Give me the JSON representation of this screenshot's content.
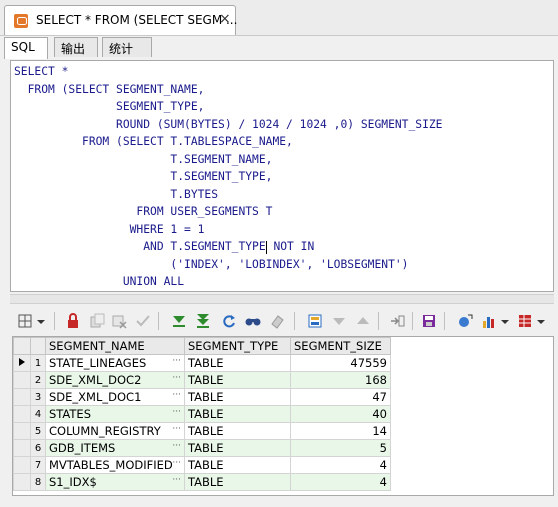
{
  "document_tab": {
    "title": "SELECT * FROM (SELECT SEGM ...",
    "close_icon": "×"
  },
  "sub_tabs": [
    {
      "label": "SQL",
      "active": true
    },
    {
      "label": "输出",
      "active": false
    },
    {
      "label": "统计",
      "active": false
    }
  ],
  "sql_lines": [
    "SELECT *",
    "  FROM (SELECT SEGMENT_NAME,",
    "               SEGMENT_TYPE,",
    "               ROUND (SUM(BYTES) / 1024 / 1024 ,0) SEGMENT_SIZE",
    "          FROM (SELECT T.TABLESPACE_NAME,",
    "                       T.SEGMENT_NAME,",
    "                       T.SEGMENT_TYPE,",
    "                       T.BYTES",
    "                  FROM USER_SEGMENTS T",
    "                 WHERE 1 = 1",
    "                   AND T.SEGMENT_TYPE",
    "                       ('INDEX', 'LOBINDEX', 'LOBSEGMENT')",
    "                UNION ALL"
  ],
  "sql_line_11_tail": " NOT IN",
  "toolbar_icons": [
    "grid-options-icon",
    "dropdown-arrow-icon",
    "lock-icon",
    "copy-icon",
    "cut-icon",
    "check-icon",
    "fetch-next-icon",
    "fetch-all-icon",
    "refresh-icon",
    "find-icon",
    "eraser-icon",
    "record-view-icon",
    "filter-down-icon",
    "filter-up-icon",
    "export-icon",
    "save-icon",
    "query-builder-icon",
    "chart-icon",
    "grid-icon"
  ],
  "grid": {
    "columns": [
      "SEGMENT_NAME",
      "SEGMENT_TYPE",
      "SEGMENT_SIZE"
    ],
    "ellipsis": "···",
    "rows": [
      {
        "num": "1",
        "name": "STATE_LINEAGES",
        "type": "TABLE",
        "size": "47559"
      },
      {
        "num": "2",
        "name": "SDE_XML_DOC2",
        "type": "TABLE",
        "size": "168"
      },
      {
        "num": "3",
        "name": "SDE_XML_DOC1",
        "type": "TABLE",
        "size": "47"
      },
      {
        "num": "4",
        "name": "STATES",
        "type": "TABLE",
        "size": "40"
      },
      {
        "num": "5",
        "name": "COLUMN_REGISTRY",
        "type": "TABLE",
        "size": "14"
      },
      {
        "num": "6",
        "name": "GDB_ITEMS",
        "type": "TABLE",
        "size": "5"
      },
      {
        "num": "7",
        "name": "MVTABLES_MODIFIED",
        "type": "TABLE",
        "size": "4"
      },
      {
        "num": "8",
        "name": "S1_IDX$",
        "type": "TABLE",
        "size": "4"
      }
    ]
  },
  "colors": {
    "sql_text": "#1a1a8c",
    "alt_row": "#e9f7e9",
    "tab_icon": "#e3782a"
  }
}
